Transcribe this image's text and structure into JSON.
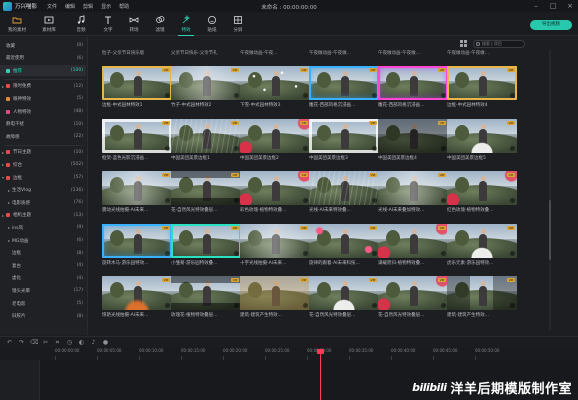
{
  "app": {
    "name": "万兴喵影",
    "menu": [
      "文件",
      "编辑",
      "剪辑",
      "显示",
      "帮助"
    ],
    "title": "未命名 : 00:00:00:00",
    "window_controls": [
      "minimize-icon",
      "maximize-icon",
      "close-icon"
    ]
  },
  "toolbar": {
    "tabs": [
      {
        "label": "我的素材",
        "icon": "folder-icon"
      },
      {
        "label": "素材库",
        "icon": "library-icon"
      },
      {
        "label": "音频",
        "icon": "music-icon"
      },
      {
        "label": "文字",
        "icon": "text-icon"
      },
      {
        "label": "转场",
        "icon": "transition-icon"
      },
      {
        "label": "滤镜",
        "icon": "filter-icon"
      },
      {
        "label": "特效",
        "icon": "effects-icon",
        "active": true
      },
      {
        "label": "贴纸",
        "icon": "sticker-icon"
      },
      {
        "label": "分屏",
        "icon": "split-screen-icon"
      }
    ],
    "export_label": "导出视频"
  },
  "sidebar": {
    "items": [
      {
        "label": "收藏",
        "count": "(0)",
        "arrow": "",
        "color": ""
      },
      {
        "label": "最近使用",
        "count": "(6)",
        "arrow": "",
        "color": ""
      },
      {
        "label": "推荐",
        "count": "(100)",
        "arrow": "",
        "color": "#2ed3b7",
        "active": true
      },
      {
        "label": "限时免费",
        "count": "(12)",
        "arrow": "▸",
        "color": "#e24c4c"
      },
      {
        "label": "眼神特效",
        "count": "(5)",
        "arrow": "",
        "color": "#e28a3b"
      },
      {
        "label": "人物特效",
        "count": "(48)",
        "arrow": "",
        "color": "#e24c8b"
      },
      {
        "label": "静电干扰",
        "count": "(10)",
        "arrow": "",
        "color": ""
      },
      {
        "label": "故障感",
        "count": "(22)",
        "arrow": "",
        "color": ""
      },
      {
        "label": "节日主题",
        "count": "(10)",
        "arrow": "▸",
        "color": "#e24c4c"
      },
      {
        "label": "综合",
        "count": "(502)",
        "arrow": "▸",
        "color": "#e24c4c"
      },
      {
        "label": "边框",
        "count": "(57)",
        "arrow": "▾",
        "color": "#e24c4c"
      },
      {
        "label": "生活Vlog",
        "count": "(136)",
        "arrow": "▸",
        "color": ""
      },
      {
        "label": "电影质感",
        "count": "(76)",
        "arrow": "▸",
        "color": ""
      },
      {
        "label": "相机主题",
        "count": "(13)",
        "arrow": "▸",
        "color": "#e24c4c"
      },
      {
        "label": "ins风",
        "count": "(9)",
        "arrow": "▸",
        "color": ""
      },
      {
        "label": "MG动画",
        "count": "(6)",
        "arrow": "▸",
        "color": ""
      },
      {
        "label": "边框",
        "count": "(8)",
        "arrow": "",
        "color": ""
      },
      {
        "label": "复古",
        "count": "(4)",
        "arrow": "",
        "color": ""
      },
      {
        "label": "虚化",
        "count": "(4)",
        "arrow": "",
        "color": ""
      },
      {
        "label": "镜头光晕",
        "count": "(17)",
        "arrow": "",
        "color": ""
      },
      {
        "label": "老电影",
        "count": "(5)",
        "arrow": "",
        "color": ""
      },
      {
        "label": "旧胶片",
        "count": "(8)",
        "arrow": "",
        "color": ""
      }
    ]
  },
  "content": {
    "search_placeholder": "搜索 | 项目",
    "top_captions": [
      "粒子-父亲节日快乐版",
      "父亲节日快乐-父亲节礼",
      "午夜做动画-午夜...",
      "午夜做动画-午夜做...",
      "午夜做动画-午夜做...",
      "午夜做动画-午夜做..."
    ],
    "rows": [
      [
        "边框-中式园林特效1",
        "竹子-中式园林特效2",
        "下雪-中式园林特效3",
        "雕花-西部风格沉浸画...",
        "雕花-西部风格沉浸画...",
        "边框-中式园林特效4"
      ],
      [
        "框架-蓝色光影沉浸画...",
        "中国美团美景边框1",
        "中国美团美景边框2",
        "中国美团美景边框3",
        "中国美团美景边框4",
        "中国美团美景边框5"
      ],
      [
        "震动光线拍摄-AI未来...",
        "花-自然风光特效叠层...",
        "彩色玫瑰-植物特效叠...",
        "光线-AI未来特效叠...",
        "光线-AI未来叠加特效...",
        "红色玫瑰-植物特效叠..."
      ],
      [
        "旋转木马-游乐园特效...",
        "小雏菊-游乐园特效叠...",
        "十字光线拍摄-AI未来...",
        "旋律的跟着-AI未来科技...",
        "满载而归-植物特效叠...",
        "虎乐元素-游乐园特效..."
      ],
      [
        "惊艳光线拍摄-AI未来...",
        "玫瑰花-植物特效叠层...",
        "建筑-建筑产生特效...",
        "花-自然风光特效叠层...",
        "花-自然风光特效叠层...",
        "建筑-建筑产生特效..."
      ]
    ],
    "badge_label": "VIP"
  },
  "timeline": {
    "ticks": [
      "00:00:00:00",
      "00:00:05:00",
      "00:00:10:00",
      "00:00:15:00",
      "00:00:20:00",
      "00:00:25:00",
      "00:00:30:00",
      "00:00:35:00",
      "00:00:40:00",
      "00:00:45:00",
      "00:00:50:00"
    ]
  },
  "watermark": {
    "brand": "bilibili",
    "text": "洋羊后期模版制作室"
  },
  "colors": {
    "accent": "#2ed3b7",
    "playhead": "#ff3b55",
    "background": "#1d1e22"
  }
}
